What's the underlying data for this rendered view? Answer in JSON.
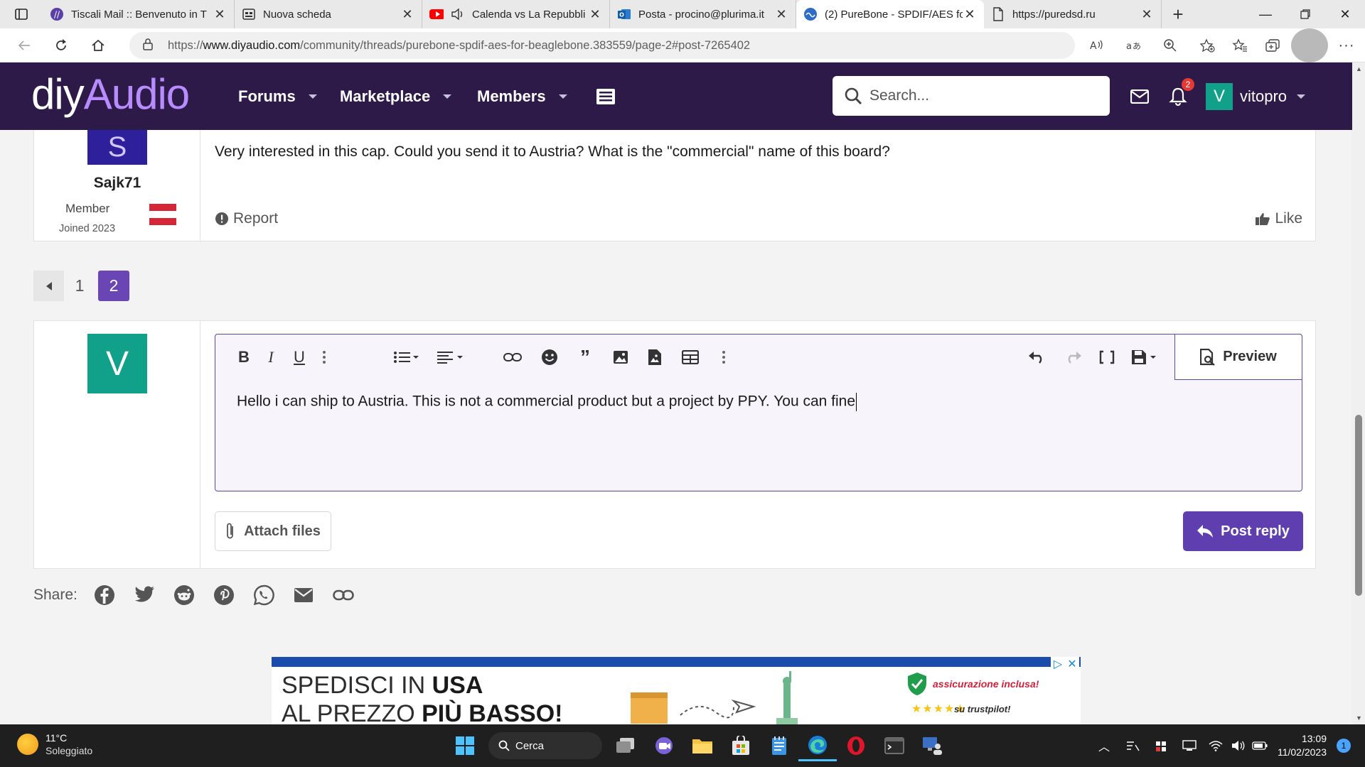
{
  "browser": {
    "tabs": [
      {
        "title": "Tiscali Mail :: Benvenuto in T",
        "icon": "tiscali-icon"
      },
      {
        "title": "Nuova scheda",
        "icon": "newtab-page-icon"
      },
      {
        "title": "Calenda vs La Repubbli",
        "icon": "youtube-icon"
      },
      {
        "title": "Posta - procino@plurima.it",
        "icon": "outlook-icon"
      },
      {
        "title": "(2) PureBone - SPDIF/AES fo",
        "icon": "diyaudio-icon"
      },
      {
        "title": "https://puredsd.ru",
        "icon": "page-icon"
      }
    ],
    "url_prefix": "https://",
    "url_domain": "www.diyaudio.com",
    "url_path": "/community/threads/purebone-spdif-aes-for-beaglebone.383559/page-2#post-7265402"
  },
  "site": {
    "logo_part1": "diy",
    "logo_part2": "Audio",
    "nav": [
      "Forums",
      "Marketplace",
      "Members"
    ],
    "search_placeholder": "Search...",
    "notification_count": "2",
    "user_initial": "V",
    "username": "vitopro"
  },
  "post": {
    "avatar_initial": "S",
    "author": "Sajk71",
    "role": "Member",
    "joined": "Joined 2023",
    "message": "Very interested in this cap. Could you send it to Austria? What is the \"commercial\" name of this board?",
    "report_label": "Report",
    "like_label": "Like"
  },
  "pagination": {
    "pages": [
      "1",
      "2"
    ],
    "current": "2"
  },
  "reply": {
    "avatar_initial": "V",
    "text": "Hello i can ship to Austria. This is not a commercial product but a project by PPY. You can fine",
    "preview_label": "Preview",
    "attach_label": "Attach files",
    "post_label": "Post reply"
  },
  "share": {
    "label": "Share:"
  },
  "ad": {
    "line1_a": "SPEDISCI IN ",
    "line1_b": "USA",
    "line2_a": "AL PREZZO ",
    "line2_b": "PIÙ BASSO!",
    "insurance": "assicurazione inclusa!",
    "trustpilot": "su trustpilot!",
    "stars": "★★★★★"
  },
  "taskbar": {
    "temperature": "11°C",
    "weather": "Soleggiato",
    "search_label": "Cerca",
    "time": "13:09",
    "date": "11/02/2023",
    "notifications": "1"
  },
  "colors": {
    "header_bg": "#2d1a49",
    "accent": "#5f3fb0",
    "logo_accent": "#b88cff",
    "avatar_teal": "#11a08a"
  }
}
